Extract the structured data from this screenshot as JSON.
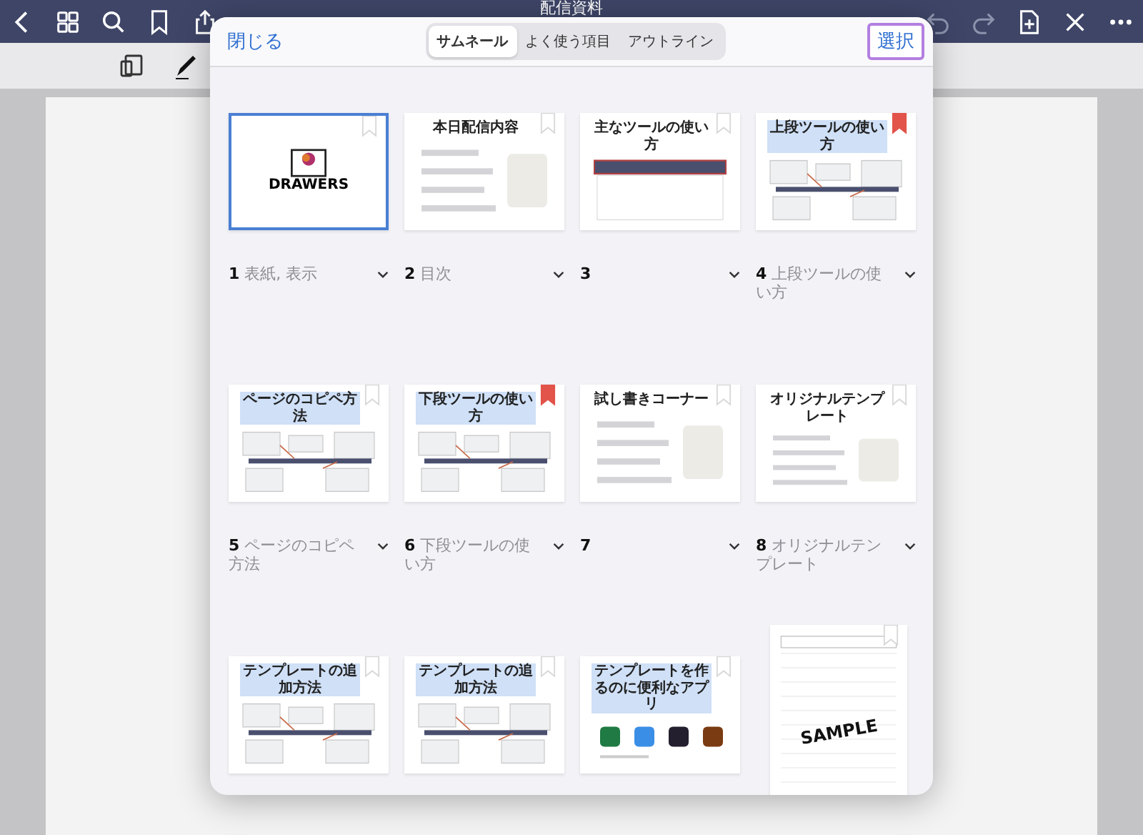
{
  "app_bar": {
    "title": "配信資料"
  },
  "sheet": {
    "close": "閉じる",
    "select": "選択",
    "tabs": [
      {
        "label": "サムネール",
        "selected": true
      },
      {
        "label": "よく使う項目",
        "selected": false
      },
      {
        "label": "アウトライン",
        "selected": false
      }
    ],
    "pages": [
      {
        "number": "1",
        "title": "表紙, 表示",
        "selected": true,
        "bookmarked": false,
        "thumb": {
          "kind": "cover",
          "heading": "DRAWERS"
        }
      },
      {
        "number": "2",
        "title": "目次",
        "selected": false,
        "bookmarked": false,
        "thumb": {
          "kind": "list",
          "heading": "本日配信内容"
        }
      },
      {
        "number": "3",
        "selected": false,
        "bookmarked": false,
        "thumb": {
          "kind": "toolbar",
          "heading": "主なツールの使い方"
        }
      },
      {
        "number": "4",
        "title": "上段ツールの使い方",
        "selected": false,
        "bookmarked": true,
        "thumb": {
          "kind": "diagram",
          "heading": "上段ツールの使い方"
        }
      },
      {
        "number": "5",
        "title": "ページのコピペ方法",
        "selected": false,
        "bookmarked": false,
        "thumb": {
          "kind": "diagram",
          "heading": "ページのコピペ方法"
        }
      },
      {
        "number": "6",
        "title": "下段ツールの使い方",
        "selected": false,
        "bookmarked": true,
        "thumb": {
          "kind": "diagram",
          "heading": "下段ツールの使い方"
        }
      },
      {
        "number": "7",
        "selected": false,
        "bookmarked": false,
        "thumb": {
          "kind": "list",
          "heading": "試し書きコーナー"
        }
      },
      {
        "number": "8",
        "title": "オリジナルテンプレート",
        "selected": false,
        "bookmarked": false,
        "thumb": {
          "kind": "list",
          "heading": "オリジナルテンプレート"
        }
      },
      {
        "selected": false,
        "bookmarked": false,
        "thumb": {
          "kind": "diagram",
          "heading": "テンプレートの追加方法"
        }
      },
      {
        "selected": false,
        "bookmarked": false,
        "thumb": {
          "kind": "diagram",
          "heading": "テンプレートの追加方法"
        }
      },
      {
        "selected": false,
        "bookmarked": false,
        "thumb": {
          "kind": "apps",
          "heading": "テンプレートを作るのに便利なアプリ"
        }
      },
      {
        "selected": false,
        "bookmarked": false,
        "thumb": {
          "kind": "sheet",
          "heading": "SAMPLE"
        }
      }
    ]
  }
}
